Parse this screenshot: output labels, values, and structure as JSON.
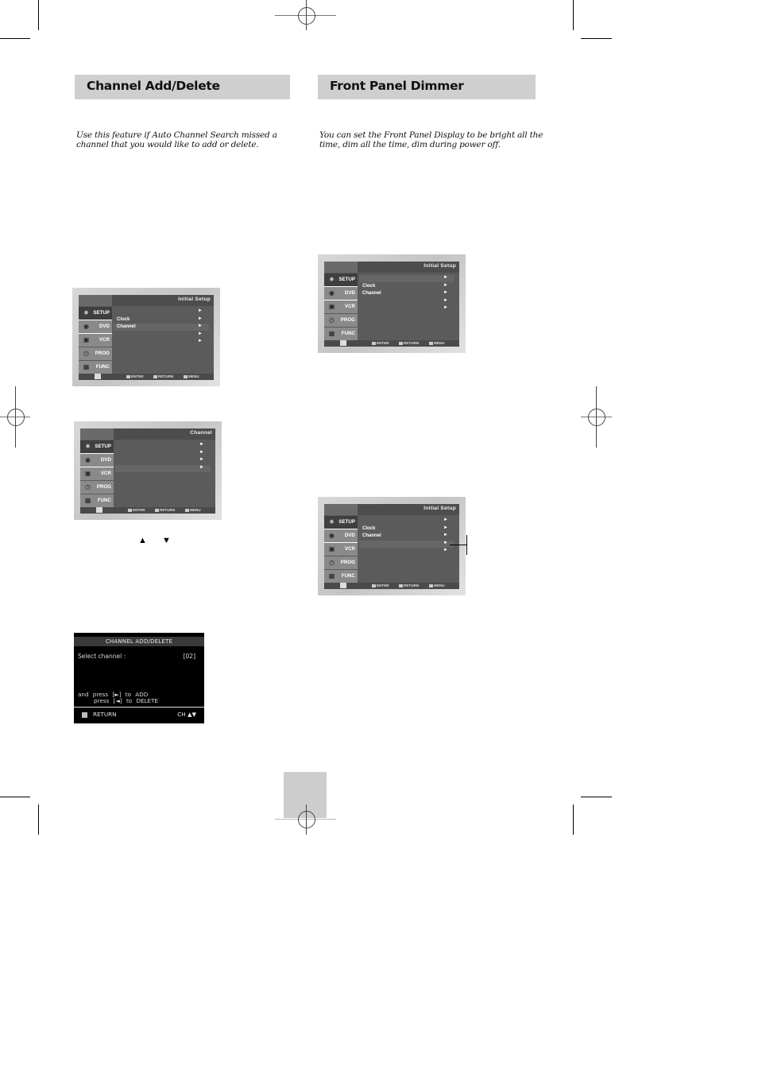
{
  "left_section": {
    "title": "Channel Add/Delete",
    "intro_line1": "Use this feature if Auto Channel Search missed a",
    "intro_line2": "channel that you would like to add or delete.",
    "menu1": {
      "title": "Initial Setup",
      "tabs": [
        {
          "icon": "gear-icon",
          "label": "SETUP",
          "active": true
        },
        {
          "icon": "disc-icon",
          "label": "DVD"
        },
        {
          "icon": "cassette-icon",
          "label": "VCR"
        },
        {
          "icon": "clock-icon",
          "label": "PROG"
        },
        {
          "icon": "function-icon",
          "label": "FUNC"
        }
      ],
      "rows": [
        {
          "label": "",
          "arrow": "►"
        },
        {
          "label": "Clock",
          "arrow": "►"
        },
        {
          "label": "Channel",
          "arrow": "►",
          "highlight": true
        },
        {
          "label": "",
          "arrow": "►"
        },
        {
          "label": "",
          "arrow": "►"
        }
      ],
      "footer": {
        "enter": "ENTER",
        "return": "RETURN",
        "menu": "MENU"
      }
    },
    "menu2": {
      "title": "Channel",
      "tabs": [
        {
          "icon": "gear-icon",
          "label": "SETUP",
          "active": true
        },
        {
          "icon": "disc-icon",
          "label": "DVD"
        },
        {
          "icon": "cassette-icon",
          "label": "VCR"
        },
        {
          "icon": "clock-icon",
          "label": "PROG"
        },
        {
          "icon": "function-icon",
          "label": "FUNC"
        }
      ],
      "rows": [
        {
          "label": "",
          "arrow": "►"
        },
        {
          "label": "",
          "arrow": "►"
        },
        {
          "label": "",
          "arrow": "►"
        },
        {
          "label": "",
          "arrow": "►",
          "highlight": true
        }
      ],
      "footer": {
        "enter": "ENTER",
        "return": "RETURN",
        "menu": "MENU"
      }
    },
    "arrow_keys": "▲ ▼",
    "dialog": {
      "title": "CHANNEL ADD/DELETE",
      "select_label": "Select channel :",
      "select_value": "[02]",
      "line1": "and press [►] to ADD",
      "line2": "press [◄] to DELETE",
      "return_label": "RETURN",
      "ch_label": "CH ▲▼"
    }
  },
  "right_section": {
    "title": "Front Panel Dimmer",
    "intro_line1": "You can set the Front Panel Display to be bright all the",
    "intro_line2": "time, dim all the time, dim during power off.",
    "menu1": {
      "title": "Initial Setup",
      "tabs": [
        {
          "icon": "gear-icon",
          "label": "SETUP",
          "active": true
        },
        {
          "icon": "disc-icon",
          "label": "DVD"
        },
        {
          "icon": "cassette-icon",
          "label": "VCR"
        },
        {
          "icon": "clock-icon",
          "label": "PROG"
        },
        {
          "icon": "function-icon",
          "label": "FUNC"
        }
      ],
      "rows": [
        {
          "label": "",
          "arrow": "►",
          "highlight": true
        },
        {
          "label": "Clock",
          "arrow": "►"
        },
        {
          "label": "Channel",
          "arrow": "►"
        },
        {
          "label": "",
          "arrow": "►"
        },
        {
          "label": "",
          "arrow": "►"
        }
      ],
      "footer": {
        "enter": "ENTER",
        "return": "RETURN",
        "menu": "MENU"
      }
    },
    "menu2": {
      "title": "Initial Setup",
      "tabs": [
        {
          "icon": "gear-icon",
          "label": "SETUP",
          "active": true
        },
        {
          "icon": "disc-icon",
          "label": "DVD"
        },
        {
          "icon": "cassette-icon",
          "label": "VCR"
        },
        {
          "icon": "clock-icon",
          "label": "PROG"
        },
        {
          "icon": "function-icon",
          "label": "FUNC"
        }
      ],
      "rows": [
        {
          "label": "",
          "arrow": "►"
        },
        {
          "label": "Clock",
          "arrow": "►"
        },
        {
          "label": "Channel",
          "arrow": "►"
        },
        {
          "label": "",
          "arrow": "►",
          "highlight": true
        },
        {
          "label": "",
          "arrow": "►"
        }
      ],
      "footer": {
        "enter": "ENTER",
        "return": "RETURN",
        "menu": "MENU"
      }
    }
  }
}
